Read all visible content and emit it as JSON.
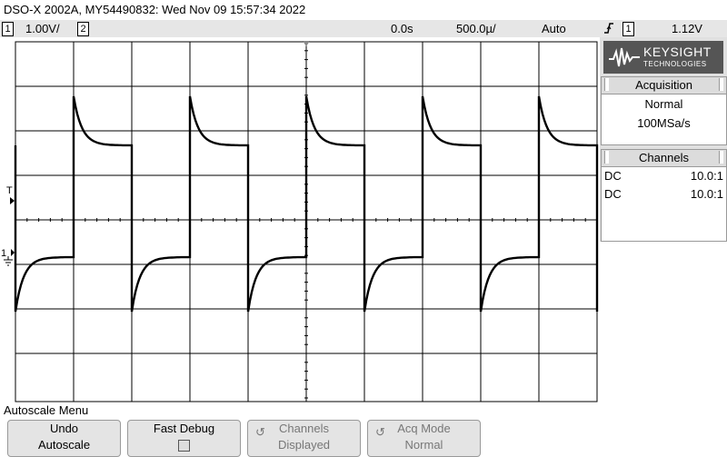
{
  "title_bar": {
    "text": "DSO-X 2002A, MY54490832: Wed Nov 09 15:57:34 2022"
  },
  "status": {
    "ch1_num": "1",
    "ch1_scale": "1.00V/",
    "ch2_num": "2",
    "time_delay": "0.0s",
    "time_scale": "500.0µ/",
    "trigger_mode": "Auto",
    "trigger_slope_icon": "rising-edge-icon",
    "trigger_source": "1",
    "trigger_level": "1.12V"
  },
  "logo": {
    "brand": "KEYSIGHT",
    "subtitle": "TECHNOLOGIES"
  },
  "acquisition": {
    "title": "Acquisition",
    "mode": "Normal",
    "rate": "100MSa/s"
  },
  "channels_panel": {
    "title": "Channels",
    "rows": [
      {
        "coupling": "DC",
        "probe": "10.0:1"
      },
      {
        "coupling": "DC",
        "probe": "10.0:1"
      }
    ]
  },
  "markers": {
    "trigger_marker": "T",
    "ground_marker": "1"
  },
  "menu": {
    "title": "Autoscale Menu",
    "softkeys": [
      {
        "line1": "Undo",
        "line2": "Autoscale"
      },
      {
        "line1": "Fast Debug",
        "line2": ""
      },
      {
        "line1": "Channels",
        "line2": "Displayed"
      },
      {
        "line1": "Acq Mode",
        "line2": "Normal"
      }
    ]
  }
}
